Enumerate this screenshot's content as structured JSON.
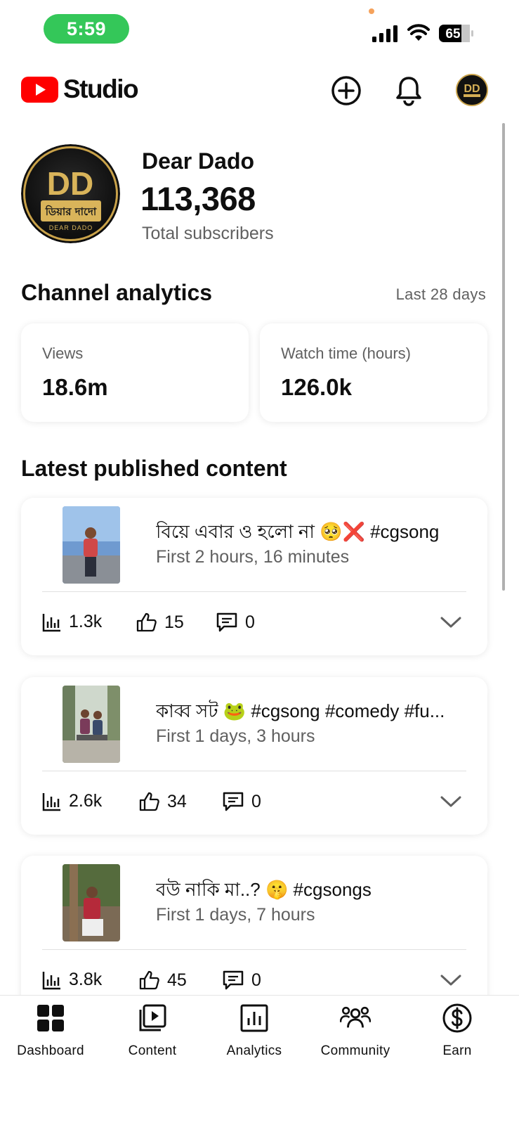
{
  "status_bar": {
    "time": "5:59",
    "battery": "65"
  },
  "header": {
    "app_name": "Studio",
    "icons": [
      "youtube-logo-icon",
      "create-plus-icon",
      "notifications-bell-icon",
      "account-avatar"
    ]
  },
  "channel": {
    "name": "Dear Dado",
    "subscribers": "113,368",
    "subscribers_label": "Total subscribers",
    "avatar_text_top": "DD",
    "avatar_text_bn": "ডিয়ার দাদো",
    "avatar_text_en": "DEAR DADO"
  },
  "analytics": {
    "title": "Channel analytics",
    "period": "Last 28 days",
    "views_label": "Views",
    "views_value": "18.6m",
    "watch_label": "Watch time (hours)",
    "watch_value": "126.0k"
  },
  "latest": {
    "title": "Latest published content",
    "items": [
      {
        "title": "বিয়ে এবার ও হলো না 🥺❌ #cgsong",
        "subtitle": "First 2 hours, 16 minutes",
        "views": "1.3k",
        "likes": "15",
        "comments": "0"
      },
      {
        "title": "কাব্ব সট 🐸 #cgsong #comedy #fu...",
        "subtitle": "First 1 days, 3 hours",
        "views": "2.6k",
        "likes": "34",
        "comments": "0"
      },
      {
        "title": "বউ নাকি মা..? 🤫 #cgsongs",
        "subtitle": "First 1 days, 7 hours",
        "views": "3.8k",
        "likes": "45",
        "comments": "0"
      }
    ]
  },
  "nav": {
    "dashboard": "Dashboard",
    "content": "Content",
    "analytics": "Analytics",
    "community": "Community",
    "earn": "Earn"
  },
  "colors": {
    "brand_red": "#ff0000",
    "status_green": "#34c759",
    "secondary_text": "#606060",
    "gold": "#c9a24a"
  }
}
